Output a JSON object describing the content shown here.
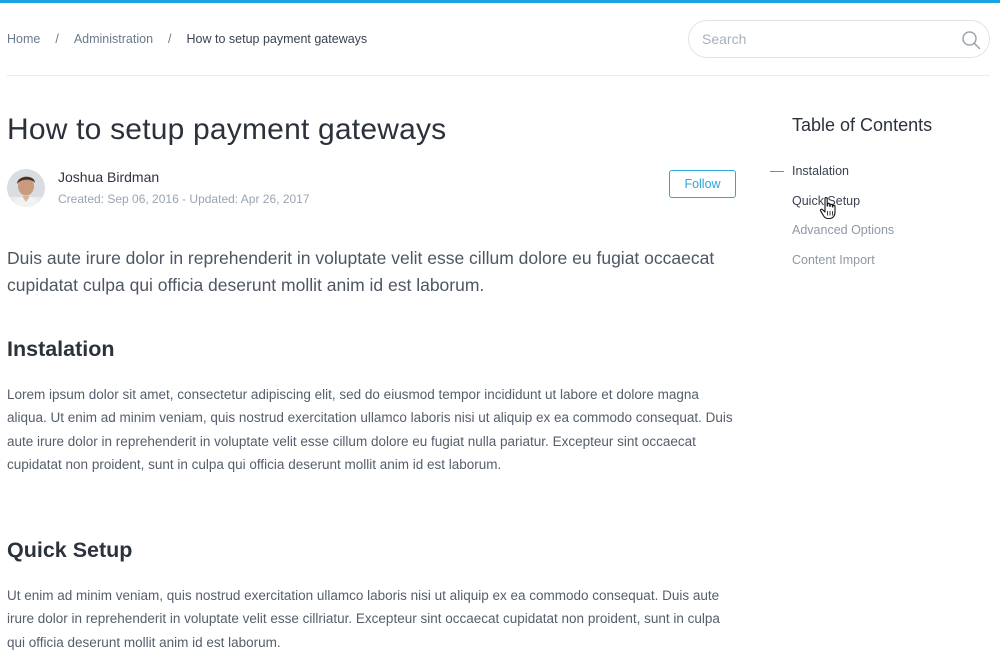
{
  "header": {
    "breadcrumb": [
      {
        "label": "Home"
      },
      {
        "label": "Administration"
      },
      {
        "label": "How to setup payment gateways"
      }
    ],
    "breadcrumb_separator": "/",
    "search": {
      "value": "",
      "placeholder": "Search",
      "icon": "search-icon"
    }
  },
  "article": {
    "title": "How to setup payment gateways",
    "author": {
      "name": "Joshua Birdman",
      "meta": "Created: Sep 06, 2016 - Updated: Apr 26, 2017",
      "avatar_icon": "avatar"
    },
    "follow_label": "Follow",
    "lead": "Duis aute irure dolor in reprehenderit in voluptate velit esse cillum dolore eu fugiat occaecat cupidatat culpa qui officia deserunt mollit anim id est laborum.",
    "sections": [
      {
        "heading": "Instalation",
        "text": "Lorem ipsum dolor sit amet, consectetur adipiscing elit, sed do eiusmod tempor incididunt ut labore et dolore magna aliqua. Ut enim ad minim veniam, quis nostrud exercitation ullamco laboris nisi ut aliquip ex ea commodo consequat. Duis aute irure dolor in reprehenderit in voluptate velit esse cillum dolore eu fugiat nulla pariatur. Excepteur sint occaecat cupidatat non proident, sunt in culpa qui officia deserunt mollit anim id est laborum."
      },
      {
        "heading": "Quick Setup",
        "text": "Ut enim ad minim veniam, quis nostrud exercitation ullamco laboris nisi ut aliquip ex ea commodo consequat. Duis aute irure dolor in reprehenderit in voluptate velit esse cillriatur. Excepteur sint occaecat cupidatat non proident, sunt in culpa qui officia deserunt mollit anim id est laborum."
      }
    ]
  },
  "toc": {
    "title": "Table of Contents",
    "items": [
      {
        "label": "Instalation",
        "state": "active"
      },
      {
        "label": "Quick Setup",
        "state": "hover"
      },
      {
        "label": "Advanced Options",
        "state": "default"
      },
      {
        "label": "Content Import",
        "state": "default"
      }
    ]
  },
  "colors": {
    "accent": "#1aa3e0",
    "button": "#29a9d9",
    "heading": "#2b323b",
    "muted": "#9aa4b0"
  }
}
